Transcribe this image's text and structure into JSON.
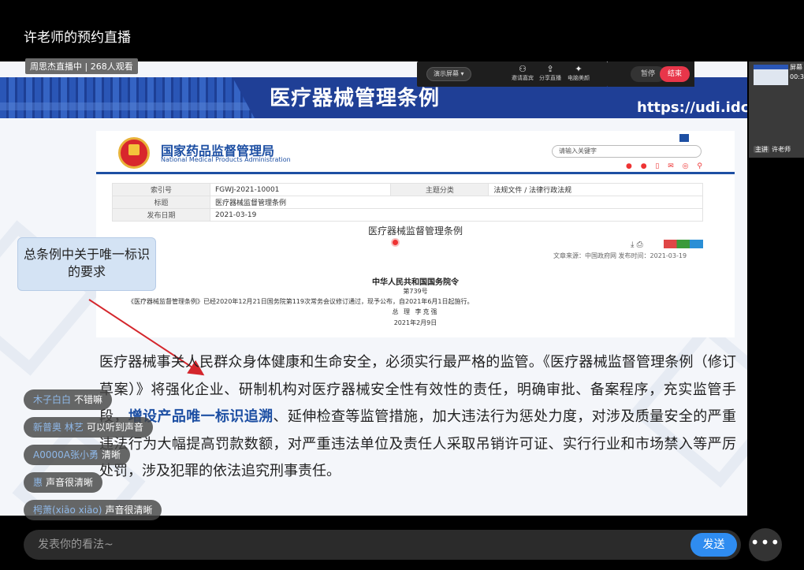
{
  "header": {
    "title": "许老师的预约直播"
  },
  "stream_status": "周思杰直播中 | 268人观看",
  "host_toolbar": {
    "present_label": "演示屏幕 ▾",
    "tools": [
      {
        "label": "邀请嘉宾",
        "icon": "user-plus-icon",
        "glyph": "⚇"
      },
      {
        "label": "分享直播",
        "icon": "share-icon",
        "glyph": "⇪"
      },
      {
        "label": "电脑美颜",
        "icon": "sparkle-icon",
        "glyph": "✦"
      }
    ],
    "pause_label": "暂停",
    "end_label": "结束"
  },
  "slide": {
    "title": "医疗器械管理条例",
    "url": "https://udi.idco",
    "callout": "总条例中关于唯一标识的要求",
    "paragraph_before": "医疗器械事关人民群众身体健康和生命安全，必须实行最严格的监管。《医疗器械监督管理条例（修订草案）》将强化企业、研制机构对医疗器械安全性有效性的责任，明确审批、备案程序，充实监管手段，",
    "paragraph_highlight": "增设产品唯一标识追溯",
    "paragraph_after": "、延伸检查等监管措施，加大违法行为惩处力度，对涉及质量安全的严重违法行为大幅提高罚款数额，对严重违法单位及责任人采取吊销许可证、实行行业和市场禁入等严厉处罚，涉及犯罪的依法追究刑事责任。"
  },
  "webpage": {
    "agency_cn": "国家药品监督管理局",
    "agency_en": "National Medical Products Administration",
    "search_placeholder": "请输入关键字",
    "table": [
      {
        "k1": "索引号",
        "v1": "FGWJ-2021-10001",
        "k2": "主题分类",
        "v2": "法规文件 / 法律行政法规"
      },
      {
        "k1": "标题",
        "v1": "医疗器械监督管理条例",
        "k2": "",
        "v2": ""
      },
      {
        "k1": "发布日期",
        "v1": "2021-03-19",
        "k2": "",
        "v2": ""
      }
    ],
    "doc_title": "医疗器械监督管理条例",
    "source": "文章来源：中国政府网 发布时间：2021-03-19",
    "order_title": "中华人民共和国国务院令",
    "order_no": "第739号",
    "body": "《医疗器械监督管理条例》已经2020年12月21日国务院第119次常务会议修订通过，现予公布，自2021年6月1日起施行。",
    "signature": "总   理    李克强",
    "date": "2021年2月9日"
  },
  "thumbnail": {
    "tag_top": "屏幕",
    "tag_bottom": "00:3",
    "badge": "主讲",
    "name": "许老师"
  },
  "chat": [
    {
      "user": "木子白白",
      "text": "不错嘛"
    },
    {
      "user": "新普奥 林艺",
      "text": "可以听到声音"
    },
    {
      "user": "A0000A张小勇",
      "text": "清晰"
    },
    {
      "user": "惠",
      "text": "声音很清晰"
    },
    {
      "user": "枵萧(xiāo xiāo)",
      "text": "声音很清晰"
    }
  ],
  "comment": {
    "placeholder": "发表你的看法~",
    "send_label": "发送",
    "more_label": "•••"
  }
}
